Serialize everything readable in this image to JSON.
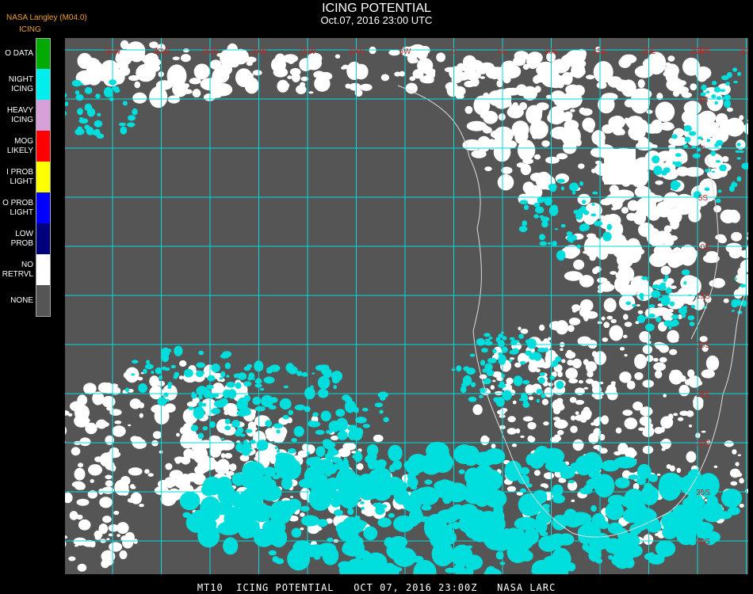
{
  "header": {
    "title": "ICING POTENTIAL",
    "timestamp": "Oct.07, 2016 23:00 UTC",
    "org": "NASA Langley (M04.0)"
  },
  "legend": {
    "title": "ICING",
    "items": [
      {
        "label": "O DATA",
        "color": "#00aa00"
      },
      {
        "label": "NIGHT\nICING",
        "color": "#00eeee"
      },
      {
        "label": "HEAVY\nICING",
        "color": "#d8a0d8"
      },
      {
        "label": "MOG\nLIKELY",
        "color": "#ff0000"
      },
      {
        "label": "I PROB\nLIGHT",
        "color": "#ffff00"
      },
      {
        "label": "O PROB\nLIGHT",
        "color": "#0000ff"
      },
      {
        "label": "LOW\nPROB",
        "color": "#00007f"
      },
      {
        "label": "NO\nRETRVL",
        "color": "#ffffff"
      },
      {
        "label": "NONE",
        "color": "#555555"
      }
    ]
  },
  "map": {
    "background_color": "#555555",
    "grid_color": "#00dddd",
    "label_color": "#cc2222",
    "land_outline_color": "#dddddd",
    "lon_labels": [
      "35W",
      "30W",
      "25W",
      "20W",
      "15W",
      "10W",
      "5W",
      "0",
      "5E",
      "10E",
      "15E",
      "20E",
      "25E",
      "30E",
      "35E",
      "40E"
    ],
    "lat_labels": [
      "10N",
      "5N",
      "0",
      "5S",
      "10S",
      "15S",
      "20S",
      "25S",
      "30S",
      "35S",
      "40S"
    ]
  },
  "footer": {
    "text": "MT10  ICING POTENTIAL   OCT 07, 2016 23:00Z   NASA LARC"
  }
}
